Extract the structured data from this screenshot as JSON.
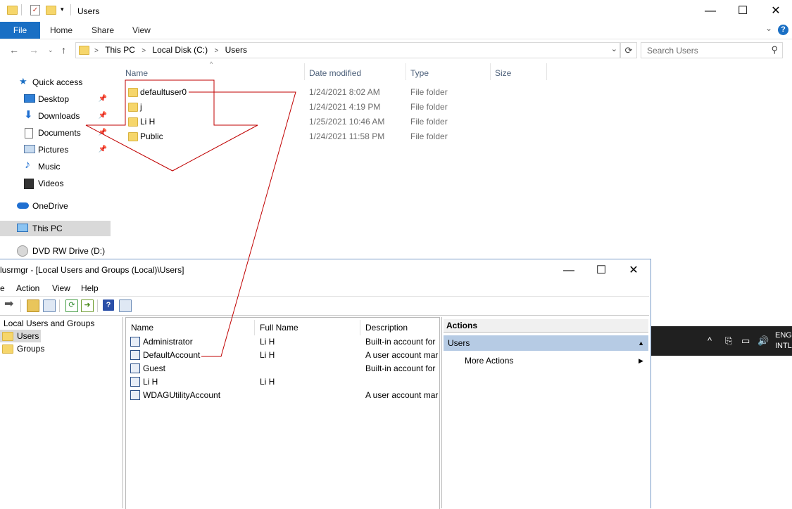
{
  "explorer": {
    "title": "Users",
    "ribbon_tabs": [
      "File",
      "Home",
      "Share",
      "View"
    ],
    "breadcrumb": [
      "This PC",
      "Local Disk (C:)",
      "Users"
    ],
    "search_placeholder": "Search Users",
    "nav": {
      "quick_access": "Quick access",
      "items": [
        {
          "label": "Desktop",
          "icon": "desktop-icon"
        },
        {
          "label": "Downloads",
          "icon": "download-icon"
        },
        {
          "label": "Documents",
          "icon": "documents-icon"
        },
        {
          "label": "Pictures",
          "icon": "pictures-icon"
        },
        {
          "label": "Music",
          "icon": "music-icon"
        },
        {
          "label": "Videos",
          "icon": "videos-icon"
        }
      ],
      "onedrive": "OneDrive",
      "this_pc": "This PC",
      "dvd": "DVD RW Drive (D:)"
    },
    "columns": {
      "name": "Name",
      "date": "Date modified",
      "type": "Type",
      "size": "Size"
    },
    "files": [
      {
        "name": "defaultuser0",
        "date": "1/24/2021 8:02 AM",
        "type": "File folder"
      },
      {
        "name": "j",
        "date": "1/24/2021 4:19 PM",
        "type": "File folder"
      },
      {
        "name": "Li H",
        "date": "1/25/2021 10:46 AM",
        "type": "File folder"
      },
      {
        "name": "Public",
        "date": "1/24/2021 11:58 PM",
        "type": "File folder"
      }
    ]
  },
  "lusrmgr": {
    "title": "lusrmgr - [Local Users and Groups (Local)\\Users]",
    "menu": [
      "e",
      "Action",
      "View",
      "Help"
    ],
    "tree": {
      "root": "Local Users and Groups (Local)",
      "users": "Users",
      "groups": "Groups"
    },
    "columns": {
      "name": "Name",
      "full_name": "Full Name",
      "description": "Description"
    },
    "users": [
      {
        "name": "Administrator",
        "full_name": "Li H",
        "description": "Built-in account for"
      },
      {
        "name": "DefaultAccount",
        "full_name": "Li H",
        "description": "A user account mar"
      },
      {
        "name": "Guest",
        "full_name": "",
        "description": "Built-in account for"
      },
      {
        "name": "Li H",
        "full_name": "Li H",
        "description": ""
      },
      {
        "name": "WDAGUtilityAccount",
        "full_name": "",
        "description": "A user account mar"
      }
    ],
    "actions": {
      "header": "Actions",
      "selected": "Users",
      "more": "More Actions"
    }
  },
  "taskbar": {
    "lang_line1": "ENG",
    "lang_line2": "INTL"
  },
  "colors": {
    "accent": "#1a6fc4",
    "annotation": "#c00000",
    "folder": "#f6d66b"
  }
}
